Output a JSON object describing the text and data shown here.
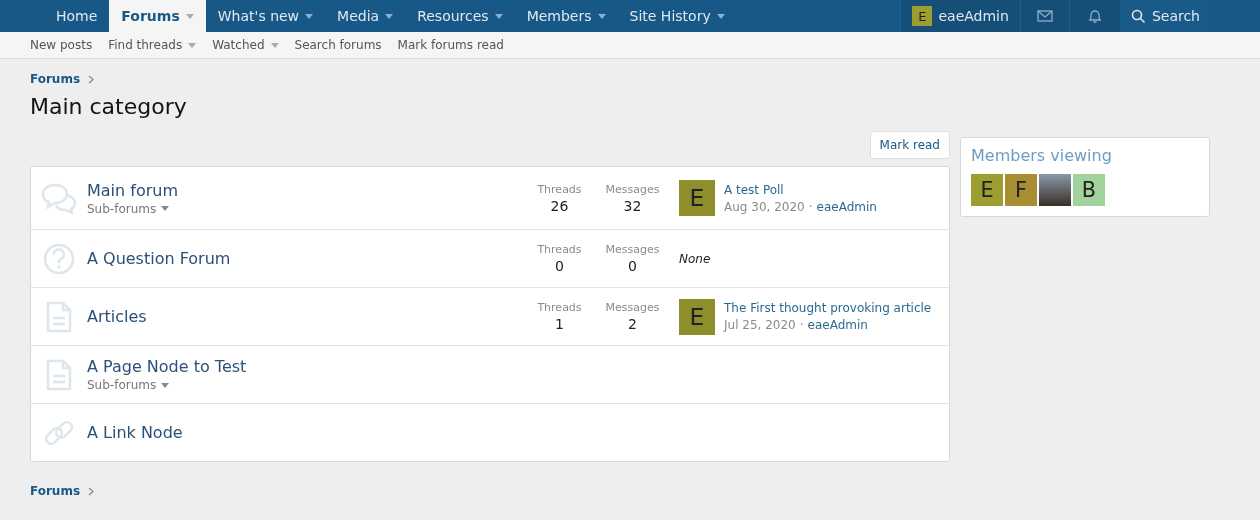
{
  "nav": {
    "tabs": [
      {
        "label": "Home",
        "selected": false,
        "has_menu": false
      },
      {
        "label": "Forums",
        "selected": true,
        "has_menu": true
      },
      {
        "label": "What's new",
        "selected": false,
        "has_menu": true
      },
      {
        "label": "Media",
        "selected": false,
        "has_menu": true
      },
      {
        "label": "Resources",
        "selected": false,
        "has_menu": true
      },
      {
        "label": "Members",
        "selected": false,
        "has_menu": true
      },
      {
        "label": "Site History",
        "selected": false,
        "has_menu": true
      }
    ],
    "user": {
      "initial": "E",
      "name": "eaeAdmin",
      "color": "#9d9d32"
    },
    "search": "Search"
  },
  "subnav": [
    {
      "label": "New posts",
      "has_menu": false
    },
    {
      "label": "Find threads",
      "has_menu": true
    },
    {
      "label": "Watched",
      "has_menu": true
    },
    {
      "label": "Search forums",
      "has_menu": false
    },
    {
      "label": "Mark forums read",
      "has_menu": false
    }
  ],
  "breadcrumb": "Forums",
  "title": "Main category",
  "mark_read": "Mark read",
  "nodes": [
    {
      "kind": "chat",
      "title": "Main forum",
      "subforums": "Sub-forums",
      "stats": {
        "threads_label": "Threads",
        "threads": "26",
        "messages_label": "Messages",
        "messages": "32"
      },
      "latest": {
        "initial": "E",
        "color": "#8e8e2b",
        "title": "A test Poll",
        "date": "Aug 30, 2020",
        "separator": "·",
        "user": "eaeAdmin"
      }
    },
    {
      "kind": "question",
      "title": "A Question Forum",
      "stats": {
        "threads_label": "Threads",
        "threads": "0",
        "messages_label": "Messages",
        "messages": "0"
      },
      "none": "None"
    },
    {
      "kind": "article",
      "title": "Articles",
      "stats": {
        "threads_label": "Threads",
        "threads": "1",
        "messages_label": "Messages",
        "messages": "2"
      },
      "latest": {
        "initial": "E",
        "color": "#8e8e2b",
        "title": "The First thought provoking article",
        "date": "Jul 25, 2020",
        "separator": "·",
        "user": "eaeAdmin"
      }
    },
    {
      "kind": "page",
      "title": "A Page Node to Test",
      "subforums": "Sub-forums"
    },
    {
      "kind": "link",
      "title": "A Link Node"
    }
  ],
  "footer_breadcrumb": "Forums",
  "members_viewing": {
    "title": "Members viewing",
    "members": [
      {
        "kind": "letter",
        "initial": "E",
        "color": "#9d9d32"
      },
      {
        "kind": "letter",
        "initial": "F",
        "color": "#a88d32"
      },
      {
        "kind": "photo"
      },
      {
        "kind": "letter",
        "initial": "B",
        "color": "#a3d39c"
      }
    ]
  }
}
